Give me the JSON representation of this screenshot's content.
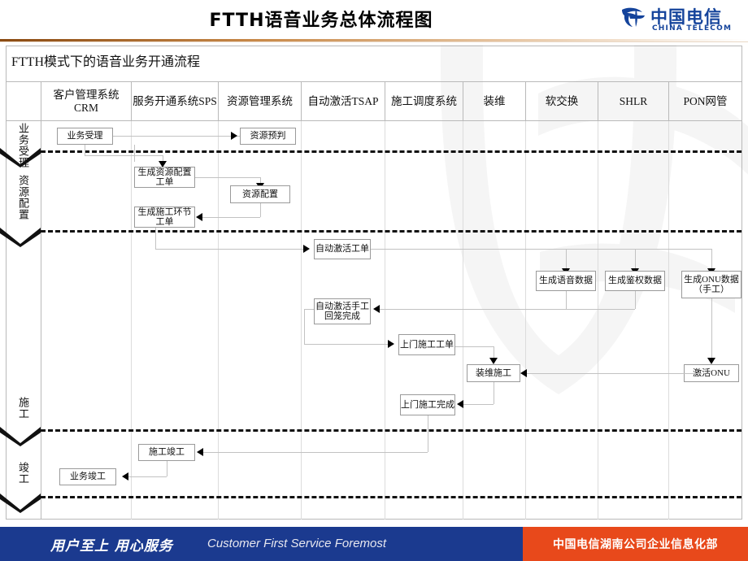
{
  "header": {
    "title": "FTTH语音业务总体流程图",
    "logo": {
      "cn": "中国电信",
      "en": "CHINA TELECOM",
      "mark": "china-telecom-logo"
    }
  },
  "panel": {
    "title": "FTTH模式下的语音业务开通流程"
  },
  "columns": [
    {
      "id": "stage",
      "label": ""
    },
    {
      "id": "crm",
      "label": "客户管理系统CRM"
    },
    {
      "id": "sps",
      "label": "服务开通系统SPS"
    },
    {
      "id": "rms",
      "label": "资源管理系统"
    },
    {
      "id": "tsap",
      "label": "自动激活TSAP"
    },
    {
      "id": "sched",
      "label": "施工调度系统"
    },
    {
      "id": "instal",
      "label": "装维"
    },
    {
      "id": "soft",
      "label": "软交换"
    },
    {
      "id": "shlr",
      "label": "SHLR"
    },
    {
      "id": "pon",
      "label": "PON网管"
    }
  ],
  "stages": [
    {
      "id": "accept",
      "label": "业务受理"
    },
    {
      "id": "resource",
      "label": "资源配置"
    },
    {
      "id": "construct",
      "label": "施工"
    },
    {
      "id": "complete",
      "label": "竣工"
    }
  ],
  "nodes": [
    {
      "id": "n1",
      "label": "业务受理"
    },
    {
      "id": "n2",
      "label": "资源预判"
    },
    {
      "id": "n3",
      "label": "生成资源配置工单"
    },
    {
      "id": "n4",
      "label": "资源配置"
    },
    {
      "id": "n5",
      "label": "生成施工环节工单"
    },
    {
      "id": "n6",
      "label": "自动激活工单"
    },
    {
      "id": "n7",
      "label": "生成语音数据"
    },
    {
      "id": "n8",
      "label": "生成鉴权数据"
    },
    {
      "id": "n9",
      "label": "生成ONU数据（手工）"
    },
    {
      "id": "n10",
      "label": "自动激活手工回笼完成"
    },
    {
      "id": "n11",
      "label": "上门施工工单"
    },
    {
      "id": "n12",
      "label": "装维施工"
    },
    {
      "id": "n13",
      "label": "激活ONU"
    },
    {
      "id": "n14",
      "label": "上门施工完成"
    },
    {
      "id": "n15",
      "label": "施工竣工"
    },
    {
      "id": "n16",
      "label": "业务竣工"
    }
  ],
  "footer": {
    "slogan_cn": "用户至上  用心服务",
    "slogan_en": "Customer First Service Foremost",
    "org": "中国电信湖南公司企业信息化部"
  },
  "colors": {
    "footer_blue": "#1b3a8f",
    "footer_orange": "#e8491b",
    "logo_blue": "#14439b",
    "rule_brown": "#8a4a12",
    "grid_gray": "#b9b9b9"
  }
}
